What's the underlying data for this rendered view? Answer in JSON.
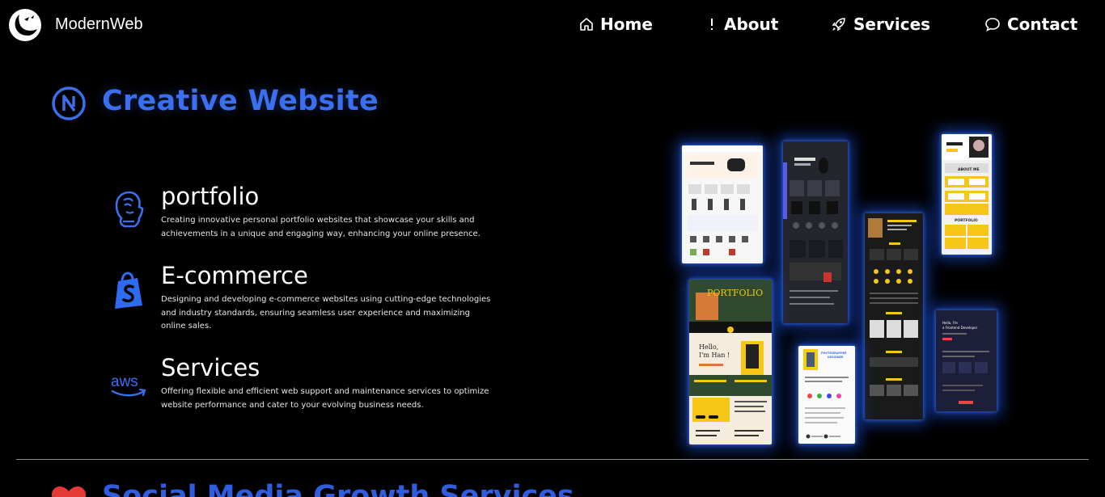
{
  "nav": {
    "brand": "ModernWeb",
    "items": [
      {
        "label": "Home",
        "icon": "home-icon"
      },
      {
        "label": "About",
        "icon": "exclamation-icon"
      },
      {
        "label": "Services",
        "icon": "rocket-icon"
      },
      {
        "label": "Contact",
        "icon": "chat-icon"
      }
    ]
  },
  "section": {
    "title": "Creative Website",
    "icon": "nextjs-icon",
    "accent": "#3a6ff0",
    "services": [
      {
        "title": "portfolio",
        "icon": "face-profile-icon",
        "description": "Creating innovative personal portfolio websites that showcase your skills and achievements in a unique and engaging way, enhancing your online presence."
      },
      {
        "title": "E-commerce",
        "icon": "shopify-icon",
        "description": "Designing and developing e-commerce websites using cutting-edge technologies and industry standards, ensuring seamless user experience and maximizing online sales."
      },
      {
        "title": "Services",
        "icon": "aws-icon",
        "description": "Offering flexible and efficient web support and maintenance services to optimize website performance and cater to your evolving business needs."
      }
    ]
  },
  "gallery": {
    "portfolio_heading": "PORTFOLIO",
    "hello_text": "Hello,\nI'm Han!",
    "about_me": "ABOUT ME",
    "photographer": "PHOTOGRAPHER & DESIGNER",
    "frontend": "Hello, I'm a Frontend Developer"
  },
  "next_section": {
    "title": "Social Media Growth Services",
    "icon": "heart-icon"
  }
}
